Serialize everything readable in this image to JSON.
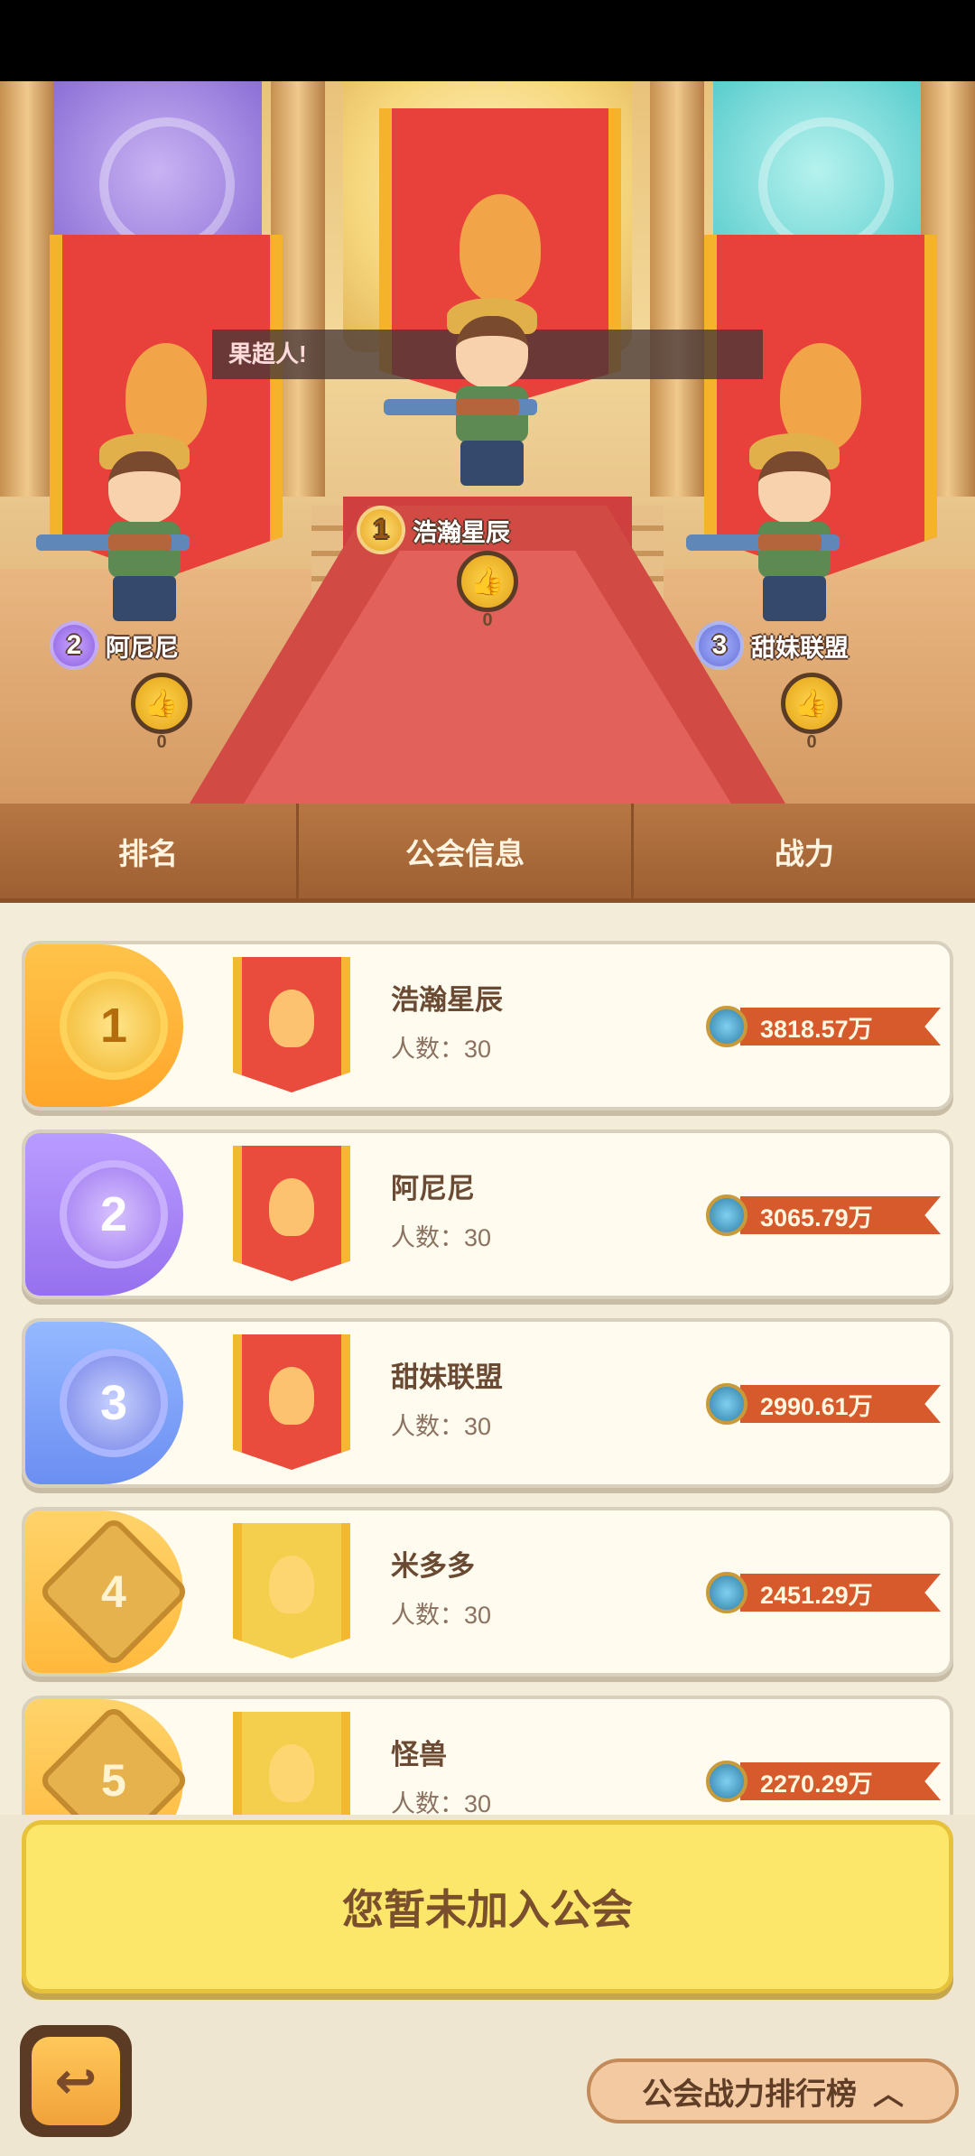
{
  "popup_text": "果超人!",
  "podium": [
    {
      "rank": "1",
      "name": "浩瀚星辰",
      "likes": "0"
    },
    {
      "rank": "2",
      "name": "阿尼尼",
      "likes": "0"
    },
    {
      "rank": "3",
      "name": "甜妹联盟",
      "likes": "0"
    }
  ],
  "table": {
    "headers": {
      "rank": "排名",
      "guild": "公会信息",
      "power": "战力"
    },
    "rows": [
      {
        "rank": "1",
        "name": "浩瀚星辰",
        "members": "人数：30",
        "power": "3818.57万"
      },
      {
        "rank": "2",
        "name": "阿尼尼",
        "members": "人数：30",
        "power": "3065.79万"
      },
      {
        "rank": "3",
        "name": "甜妹联盟",
        "members": "人数：30",
        "power": "2990.61万"
      },
      {
        "rank": "4",
        "name": "米多多",
        "members": "人数：30",
        "power": "2451.29万"
      },
      {
        "rank": "5",
        "name": "怪兽",
        "members": "人数：30",
        "power": "2270.29万"
      }
    ]
  },
  "notice": "您暂未加入公会",
  "footer": {
    "back_icon": "back-arrow-icon",
    "ranking_button": "公会战力排行榜",
    "ranking_icon": "chevron-up-icon"
  },
  "icons": {
    "like": "thumbs-up-icon",
    "power": "key-icon"
  }
}
